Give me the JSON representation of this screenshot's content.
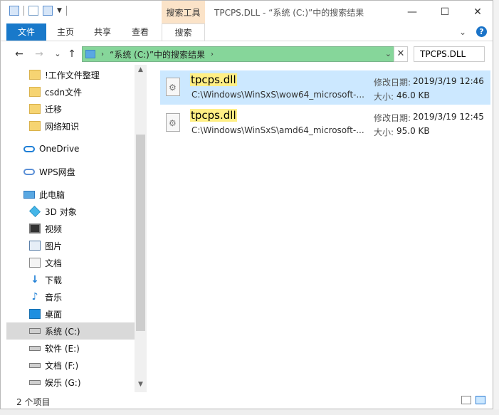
{
  "titlebar": {
    "context_tab": "搜索工具",
    "title": "TPCPS.DLL - “系统 (C:)”中的搜索结果",
    "minimize": "—",
    "maximize": "☐",
    "close": "✕"
  },
  "ribbon": {
    "tabs": [
      "文件",
      "主页",
      "共享",
      "查看",
      "搜索"
    ],
    "expand": "⌄",
    "help": "?"
  },
  "nav": {
    "back": "←",
    "forward": "→",
    "recent": "⌄",
    "up": "↑",
    "address": "“系统 (C:)”中的搜索结果",
    "address_dropdown": "⌄",
    "clear": "✕",
    "search_value": "TPCPS.DLL"
  },
  "sidebar": {
    "items": [
      {
        "label": "!工作文件整理",
        "icon": "folder-icon"
      },
      {
        "label": "csdn文件",
        "icon": "folder-icon"
      },
      {
        "label": "迁移",
        "icon": "folder-icon"
      },
      {
        "label": "网络知识",
        "icon": "folder-icon"
      },
      {
        "label": "OneDrive",
        "icon": "onedrive-icon"
      },
      {
        "label": "WPS网盘",
        "icon": "wps-cloud-icon"
      },
      {
        "label": "此电脑",
        "icon": "computer-icon"
      },
      {
        "label": "3D 对象",
        "icon": "3d-objects-icon"
      },
      {
        "label": "视频",
        "icon": "video-icon"
      },
      {
        "label": "图片",
        "icon": "pictures-icon"
      },
      {
        "label": "文档",
        "icon": "documents-icon"
      },
      {
        "label": "下载",
        "icon": "download-icon"
      },
      {
        "label": "音乐",
        "icon": "music-icon"
      },
      {
        "label": "桌面",
        "icon": "desktop-icon"
      },
      {
        "label": "系统 (C:)",
        "icon": "drive-c-icon"
      },
      {
        "label": "软件 (E:)",
        "icon": "drive-icon"
      },
      {
        "label": "文档 (F:)",
        "icon": "drive-icon"
      },
      {
        "label": "娱乐 (G:)",
        "icon": "drive-icon"
      }
    ]
  },
  "results": [
    {
      "name": "tpcps.dll",
      "path": "C:\\Windows\\WinSxS\\wow64_microsoft-...",
      "modified_label": "修改日期:",
      "modified": "2019/3/19 12:46",
      "size_label": "大小:",
      "size": "46.0 KB"
    },
    {
      "name": "tpcps.dll",
      "path": "C:\\Windows\\WinSxS\\amd64_microsoft-...",
      "modified_label": "修改日期:",
      "modified": "2019/3/19 12:45",
      "size_label": "大小:",
      "size": "95.0 KB"
    }
  ],
  "status": {
    "count": "2 个项目"
  },
  "colors": {
    "accent": "#1979ca",
    "address_bar": "#86d69a",
    "selection": "#cce8ff",
    "highlight": "#ffef85",
    "context_tab": "#fbe3c8"
  }
}
